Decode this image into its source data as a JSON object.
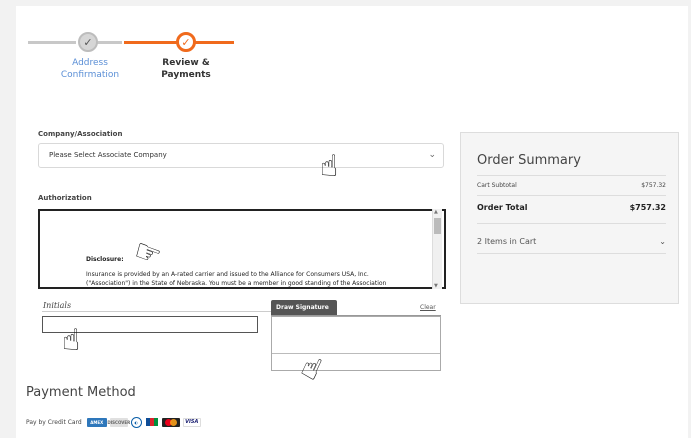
{
  "stepper": {
    "steps": [
      {
        "label_line1": "Address",
        "label_line2": "Confirmation",
        "state": "done"
      },
      {
        "label": "Review & Payments",
        "state": "active"
      }
    ],
    "check_glyph": "✓"
  },
  "company": {
    "label": "Company/Association",
    "selected": "Please Select Associate Company",
    "chevron": "⌄"
  },
  "authorization": {
    "label": "Authorization",
    "disclosure_title": "Disclosure:",
    "disclosure_line1": "Insurance is provided by an A-rated carrier and issued to the Alliance for Consumers USA, Inc.",
    "disclosure_line2": "(\"Association\") in the State of Nebraska. You must be a member in good standing of the Association"
  },
  "initials": {
    "label": "Initials",
    "value": ""
  },
  "signature": {
    "tab_label": "Draw Signature",
    "clear_label": "Clear"
  },
  "payment": {
    "title": "Payment Method",
    "pay_text": "Pay by Credit Card",
    "cards": [
      "amex",
      "discover",
      "diners",
      "jcb",
      "mastercard",
      "visa"
    ],
    "amex_text": "AMEX",
    "visa_text": "VISA",
    "discover_text": "DISCOVER"
  },
  "summary": {
    "title": "Order Summary",
    "cart_subtotal_label": "Cart Subtotal",
    "cart_subtotal_value": "$757.32",
    "order_total_label": "Order Total",
    "order_total_value": "$757.32",
    "items_label": "2 Items in Cart",
    "chevron": "⌄"
  },
  "colors": {
    "accent": "#f06a1c",
    "link": "#5b8fd6"
  },
  "icons": {
    "hand_pointer": "☝",
    "hand_point_right": "☞"
  }
}
